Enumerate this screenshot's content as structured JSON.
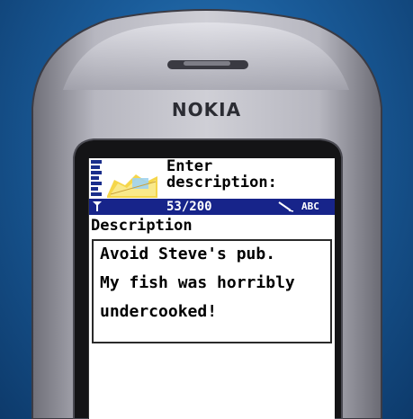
{
  "phone": {
    "brand": "NOKIA"
  },
  "header": {
    "prompt_line1": "Enter",
    "prompt_line2": "description:"
  },
  "status_bar": {
    "char_counter": "53/200",
    "input_mode": "ABC"
  },
  "field": {
    "label": "Description",
    "lines": [
      "Avoid Steve's pub.",
      "My fish was horribly",
      "undercooked!"
    ]
  },
  "colors": {
    "accent_bar": "#17248a",
    "background": "#1a5c9a",
    "phone_body": "#a9a9b3"
  },
  "icons": [
    "signal-strength-icon",
    "context-app-icon",
    "pen-input-icon"
  ]
}
